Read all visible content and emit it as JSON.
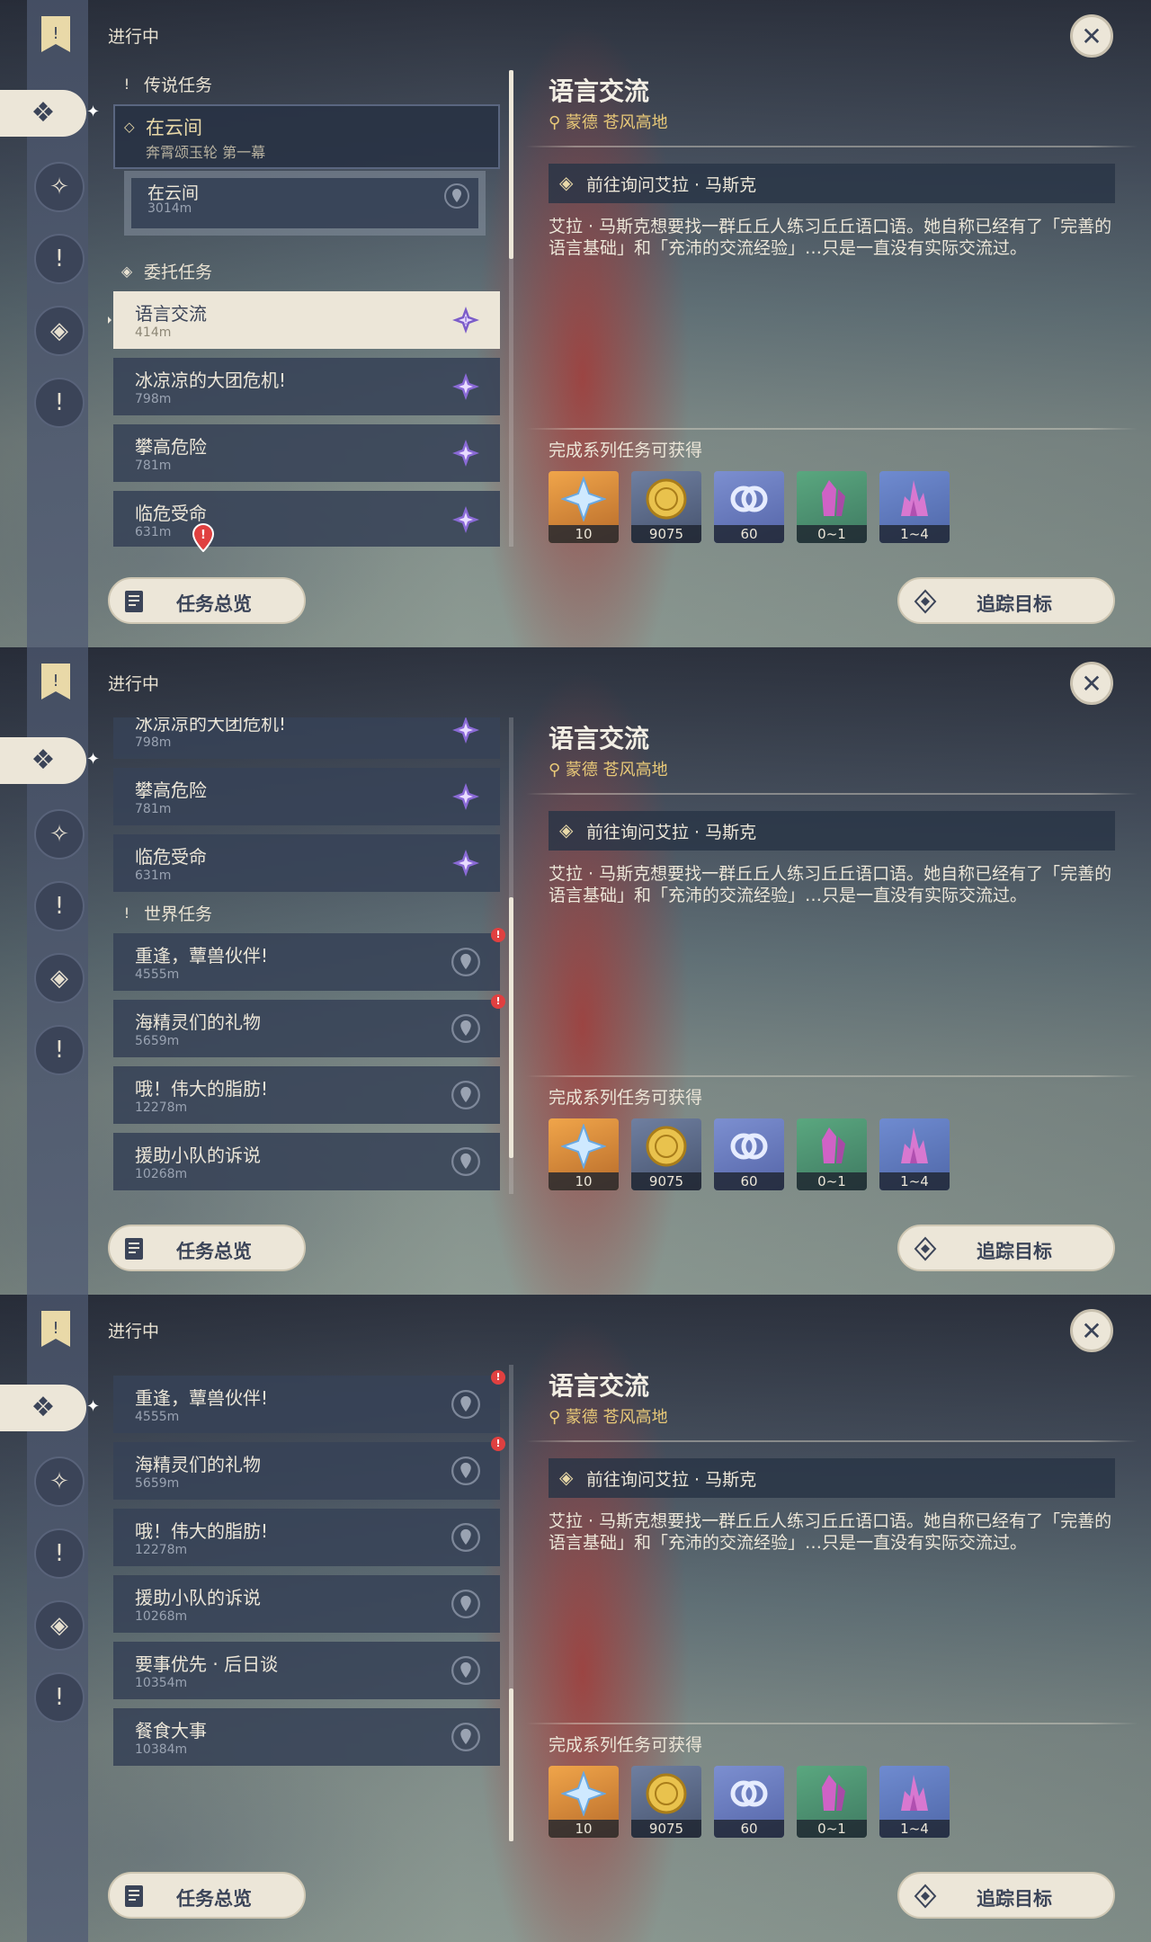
{
  "status_label": "进行中",
  "close_symbol": "✕",
  "sections": {
    "legend": "传说任务",
    "commission": "委托任务",
    "world": "世界任务"
  },
  "legend_quest": {
    "title": "在云间",
    "chapter": "奔霄颂玉轮 第一幕"
  },
  "legend_sub": {
    "title": "在云间",
    "distance": "3014m"
  },
  "quests": [
    {
      "title": "语言交流",
      "distance": "414m"
    },
    {
      "title": "冰凉凉的大团危机!",
      "distance": "798m"
    },
    {
      "title": "攀高危险",
      "distance": "781m"
    },
    {
      "title": "临危受命",
      "distance": "631m"
    },
    {
      "title": "重逢，蕈兽伙伴!",
      "distance": "4555m"
    },
    {
      "title": "海精灵们的礼物",
      "distance": "5659m"
    },
    {
      "title": "哦！伟大的脂肪!",
      "distance": "12278m"
    },
    {
      "title": "援助小队的诉说",
      "distance": "10268m"
    },
    {
      "title": "要事优先 · 后日谈",
      "distance": "10354m"
    },
    {
      "title": "餐食大事",
      "distance": "10384m"
    }
  ],
  "detail": {
    "title": "语言交流",
    "location": "蒙德 苍风高地",
    "objective": "前往询问艾拉 · 马斯克",
    "description": "艾拉 · 马斯克想要找一群丘丘人练习丘丘语口语。她自称已经有了「完善的语言基础」和「充沛的交流经验」…只是一直没有实际交流过。",
    "rewards_label": "完成系列任务可获得",
    "rewards": [
      {
        "icon": "primogem-icon",
        "count": "10"
      },
      {
        "icon": "mora-icon",
        "count": "9075"
      },
      {
        "icon": "adventure-exp-icon",
        "count": "60"
      },
      {
        "icon": "crystal-chunk-icon",
        "count": "0~1"
      },
      {
        "icon": "crystal-cluster-icon",
        "count": "1~4"
      }
    ]
  },
  "buttons": {
    "overview": "任务总览",
    "track": "追踪目标"
  },
  "colors": {
    "cream": "#ece6d8",
    "navy": "#3b4458",
    "gold": "#e9c978",
    "alert": "#e04040"
  }
}
